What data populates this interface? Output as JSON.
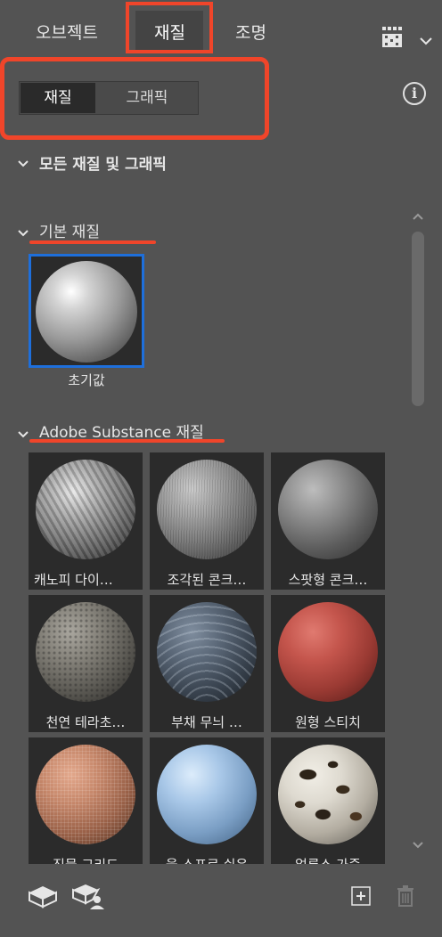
{
  "tabs": [
    {
      "label": "오브젝트"
    },
    {
      "label": "재질"
    },
    {
      "label": "조명"
    }
  ],
  "segments": {
    "materials": "재질",
    "graphics": "그래픽"
  },
  "sections": {
    "all": "모든 재질 및 그래픽",
    "basic": "기본 재질",
    "adobe": "Adobe Substance 재질"
  },
  "basic_material": {
    "label": "초기값"
  },
  "materials": [
    {
      "label": "캐노피 다이…"
    },
    {
      "label": "조각된 콘크…"
    },
    {
      "label": "스팟형 콘크…"
    },
    {
      "label": "천연 테라초…"
    },
    {
      "label": "부채 무늬 …"
    },
    {
      "label": "원형 스티치"
    },
    {
      "label": "직물 그리드"
    },
    {
      "label": "울 스프로 쉬운"
    },
    {
      "label": "얼룩소 가죽"
    }
  ],
  "colors": {
    "accent": "#f0452a",
    "selected": "#1e6fdb",
    "panel": "#535353"
  },
  "icons": [
    "view-options-icon",
    "chevron-down-icon",
    "info-icon",
    "add-3d-object-icon",
    "user-object-icon",
    "add-icon",
    "trash-icon"
  ]
}
